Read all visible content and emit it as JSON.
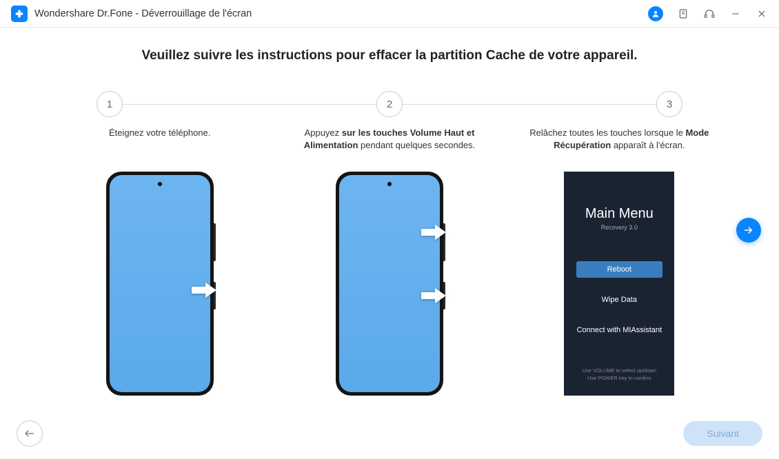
{
  "app": {
    "title": "Wondershare Dr.Fone - Déverrouillage de l'écran"
  },
  "heading": "Veuillez suivre les instructions pour effacer la partition Cache de votre appareil.",
  "steps": [
    {
      "num": "1",
      "desc_plain": "Éteignez votre téléphone."
    },
    {
      "num": "2",
      "desc_pre": "Appuyez ",
      "desc_bold": "sur les touches Volume Haut et Alimentation",
      "desc_post": " pendant quelques secondes."
    },
    {
      "num": "3",
      "desc_pre": "Relâchez toutes les touches lorsque le ",
      "desc_bold": "Mode Récupération",
      "desc_post": " apparaît à l'écran."
    }
  ],
  "recovery": {
    "title": "Main Menu",
    "subtitle": "Recovery 3.0",
    "reboot": "Reboot",
    "wipe": "Wipe Data",
    "connect": "Connect with MIAssistant",
    "hint1": "Use VOLUME to select up/down",
    "hint2": "Use POWER key to confirm"
  },
  "buttons": {
    "next": "Suivant"
  }
}
